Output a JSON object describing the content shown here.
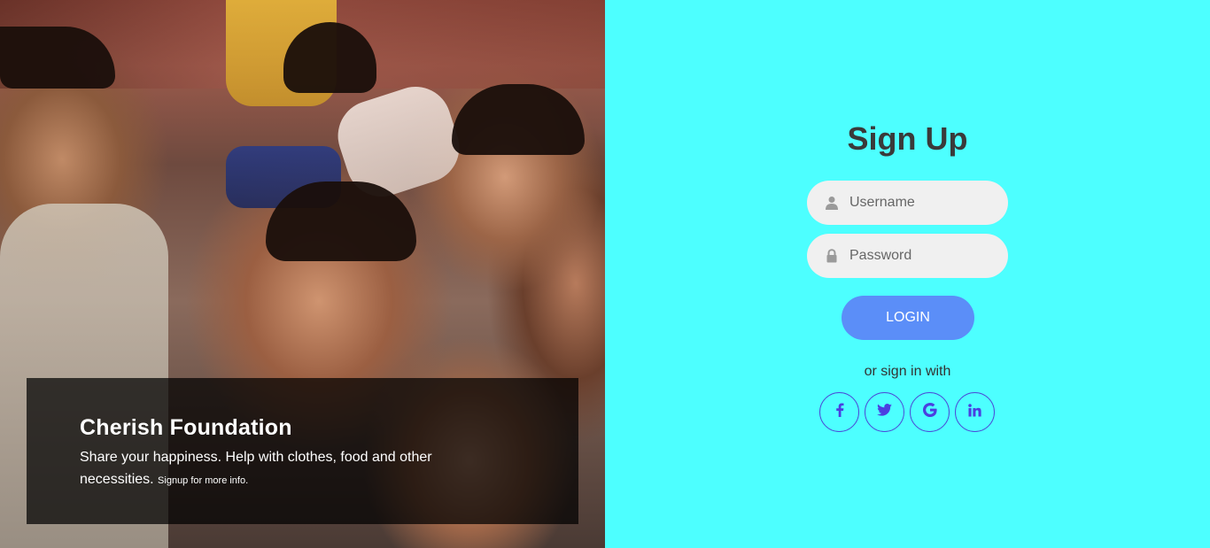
{
  "hero": {
    "title": "Cherish Foundation",
    "description": "Share your happiness. Help with clothes, food and other necessities.",
    "note": "Signup for more info."
  },
  "form": {
    "title": "Sign Up",
    "username_placeholder": "Username",
    "password_placeholder": "Password",
    "login_label": "LOGIN",
    "alt_text": "or sign in with",
    "socials": [
      {
        "name": "facebook",
        "glyph": "f"
      },
      {
        "name": "twitter",
        "glyph": "twitter-bird"
      },
      {
        "name": "google",
        "glyph": "G"
      },
      {
        "name": "linkedin",
        "glyph": "in"
      }
    ]
  },
  "colors": {
    "panel_bg": "#4dffff",
    "button": "#5b8ef8",
    "field_bg": "#f0f0f0",
    "social_accent": "#4b3fe0",
    "title_text": "#3a3a3a"
  },
  "icons": {
    "username": "user-icon",
    "password": "lock-icon"
  }
}
